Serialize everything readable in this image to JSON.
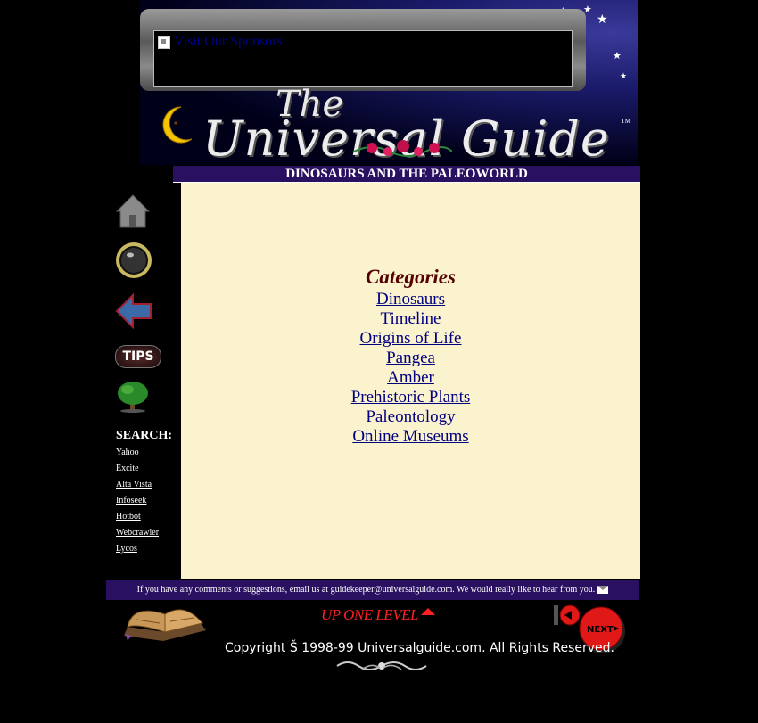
{
  "header": {
    "sponsor_link": "Visit Our Sponsors",
    "logo_the": "The",
    "logo_main": "Universal Guide",
    "logo_tm": "TM"
  },
  "title_bar": {
    "text": "DINOSAURS AND THE PALEOWORLD"
  },
  "left_nav": {
    "icons": [
      "home-icon",
      "moon-ball-icon",
      "back-arrow-icon",
      "tips-icon",
      "tree-icon"
    ],
    "tips_label": "TIPS",
    "search_title": "SEARCH:",
    "search_links": [
      "Yahoo",
      "Excite",
      "Alta Vista",
      "Infoseek",
      "Hotbot",
      "Webcrawler",
      "Lycos"
    ]
  },
  "main": {
    "categories_title": "Categories",
    "categories": [
      "Dinosaurs",
      "Timeline",
      "Origins of Life",
      "Pangea",
      "Amber",
      "Prehistoric Plants",
      "Paleontology",
      "Online Museums"
    ]
  },
  "footer": {
    "comment_text": "If you have any comments or suggestions, email us at guidekeeper@universalguide.com.  We would really like to hear from you.",
    "up_level": "UP ONE LEVEL",
    "next_label": "NEXT",
    "copyright": "Copyright Š 1998-99 Universalguide.com. All Rights Reserved."
  },
  "colors": {
    "background": "#000000",
    "title_bar": "#2a1060",
    "content_bg": "#fbf3cd",
    "category_title": "#550000",
    "link": "#000080",
    "up_level": "#ff2020"
  }
}
